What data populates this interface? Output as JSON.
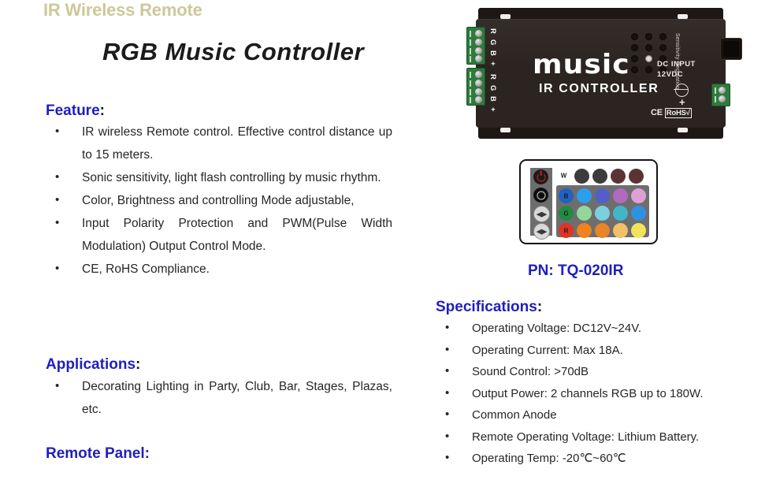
{
  "header": {
    "subtitle": "IR Wireless Remote",
    "title": "RGB Music Controller",
    "subtitle_color": "#cdc89a",
    "title_color": "#1b1b1b"
  },
  "accent_color": "#1f1fbe",
  "feature": {
    "heading": "Feature",
    "colon": ":",
    "items": [
      "IR wireless Remote control. Effective control distance up to 15 meters.",
      "Sonic sensitivity, light flash controlling by music rhythm.",
      "Color, Brightness and controlling Mode adjustable,",
      "Input Polarity Protection and PWM(Pulse Width Modulation) Output Control Mode.",
      "CE, RoHS Compliance."
    ]
  },
  "applications": {
    "heading": "Applications",
    "colon": ":",
    "items": [
      "Decorating Lighting in Party, Club, Bar, Stages, Plazas, etc."
    ]
  },
  "remote_panel": {
    "heading": "Remote Panel:"
  },
  "device": {
    "logo": "music",
    "logo_sub": "IR CONTROLLER",
    "dc_input_line1": "DC INPUT",
    "dc_input_line2": "12VDC",
    "sensitivity_label": "Sensitivity Regulation",
    "plus": "+",
    "ce_mark": "CE",
    "rohs_mark": "RoHS√",
    "terminal_top_labels": [
      "R",
      "G",
      "B",
      "+"
    ],
    "terminal_bottom_labels": [
      "R",
      "G",
      "B",
      "+"
    ],
    "body_color": "#2b2421",
    "terminal_color": "#2f7a3c"
  },
  "remote": {
    "side_buttons": [
      {
        "name": "power",
        "glyph": "power"
      },
      {
        "name": "brightness",
        "glyph": "circle"
      },
      {
        "name": "arrow-right",
        "glyph": "◀▶"
      },
      {
        "name": "arrow-left",
        "glyph": "◀▶"
      }
    ],
    "top_row": [
      {
        "label": "W",
        "color": "#ffffff"
      },
      {
        "label": "",
        "color": "#3c3c3c"
      },
      {
        "label": "",
        "color": "#3c3c3c"
      },
      {
        "label": "",
        "color": "#5a3434"
      },
      {
        "label": "",
        "color": "#5a3434"
      }
    ],
    "rows": [
      [
        {
          "label": "B",
          "color": "#1f62c4"
        },
        {
          "label": "",
          "color": "#2d9ded"
        },
        {
          "label": "",
          "color": "#5160c8"
        },
        {
          "label": "",
          "color": "#b06ac0"
        },
        {
          "label": "",
          "color": "#dfa0d6"
        }
      ],
      [
        {
          "label": "G",
          "color": "#1f8c42"
        },
        {
          "label": "",
          "color": "#93d79a"
        },
        {
          "label": "",
          "color": "#7ccfdd"
        },
        {
          "label": "",
          "color": "#3fb7c9"
        },
        {
          "label": "",
          "color": "#2f92e0"
        }
      ],
      [
        {
          "label": "R",
          "color": "#e03226"
        },
        {
          "label": "",
          "color": "#f0821f"
        },
        {
          "label": "",
          "color": "#e8842a"
        },
        {
          "label": "",
          "color": "#f2c067"
        },
        {
          "label": "",
          "color": "#f2e35a"
        }
      ]
    ]
  },
  "part_number": "PN: TQ-020IR",
  "specifications": {
    "heading": "Specifications",
    "colon": ":",
    "items": [
      "Operating Voltage: DC12V~24V.",
      "Operating Current: Max 18A.",
      "Sound Control: >70dB",
      "Output Power: 2 channels  RGB up to 180W.",
      "Common   Anode",
      "Remote Operating Voltage: Lithium Battery.",
      "Operating Temp: -20℃~60℃"
    ]
  }
}
